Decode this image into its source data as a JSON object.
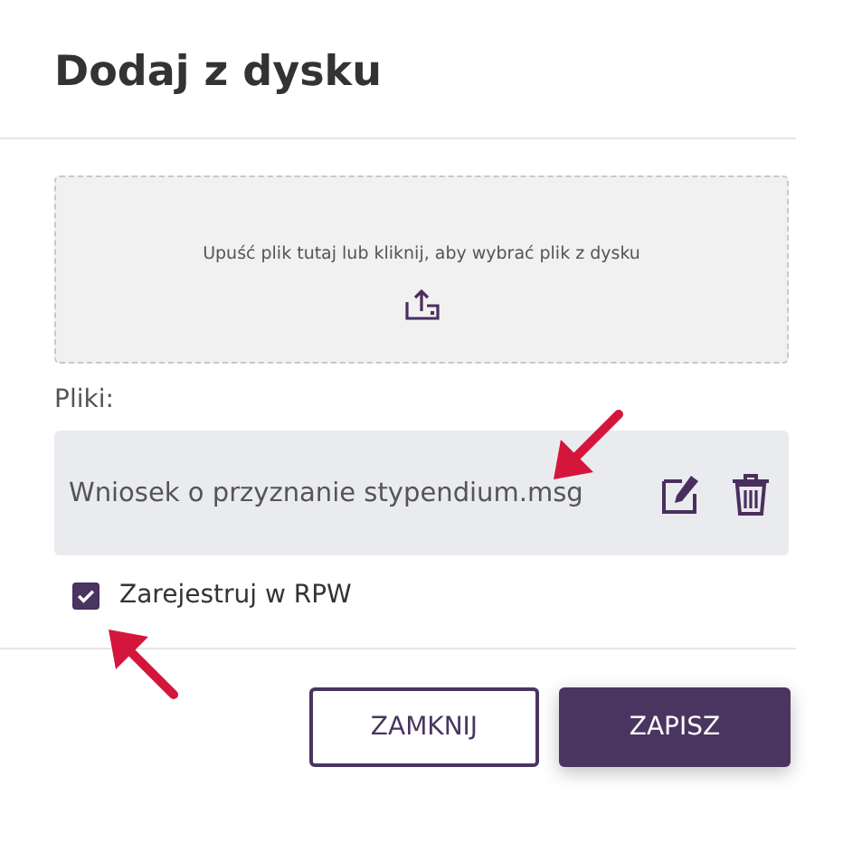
{
  "dialog": {
    "title": "Dodaj z dysku",
    "dropzone": {
      "text": "Upuść plik tutaj lub kliknij, aby wybrać plik z dysku"
    },
    "files_label": "Pliki:",
    "files": [
      {
        "name": "Wniosek o przyznanie stypendium.msg"
      }
    ],
    "register": {
      "label": "Zarejestruj w RPW",
      "checked": true
    },
    "buttons": [
      {
        "label": "ZAMKNIJ",
        "kind": "secondary"
      },
      {
        "label": "ZAPISZ",
        "kind": "primary"
      }
    ]
  }
}
